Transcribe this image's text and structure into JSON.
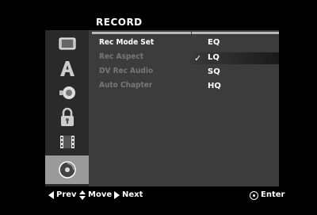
{
  "title": "RECORD",
  "sidebar": {
    "icons": [
      {
        "name": "tv-display-icon"
      },
      {
        "name": "language-a-icon"
      },
      {
        "name": "audio-speaker-icon"
      },
      {
        "name": "lock-icon"
      },
      {
        "name": "film-strip-icon"
      },
      {
        "name": "disc-icon"
      }
    ]
  },
  "menu": {
    "items": [
      {
        "label": "Rec Mode Set",
        "state": "selected"
      },
      {
        "label": "Rec Aspect",
        "state": "dim"
      },
      {
        "label": "DV Rec Audio",
        "state": "dim"
      },
      {
        "label": "Auto Chapter",
        "state": "dim"
      }
    ]
  },
  "options": [
    {
      "label": "EQ",
      "checked": false
    },
    {
      "label": "LQ",
      "checked": true
    },
    {
      "label": "SQ",
      "checked": false
    },
    {
      "label": "HQ",
      "checked": false
    }
  ],
  "check_glyph": "✓",
  "nav": {
    "prev_label": "Prev",
    "move_label": "Move",
    "next_label": "Next",
    "enter_label": "Enter"
  }
}
